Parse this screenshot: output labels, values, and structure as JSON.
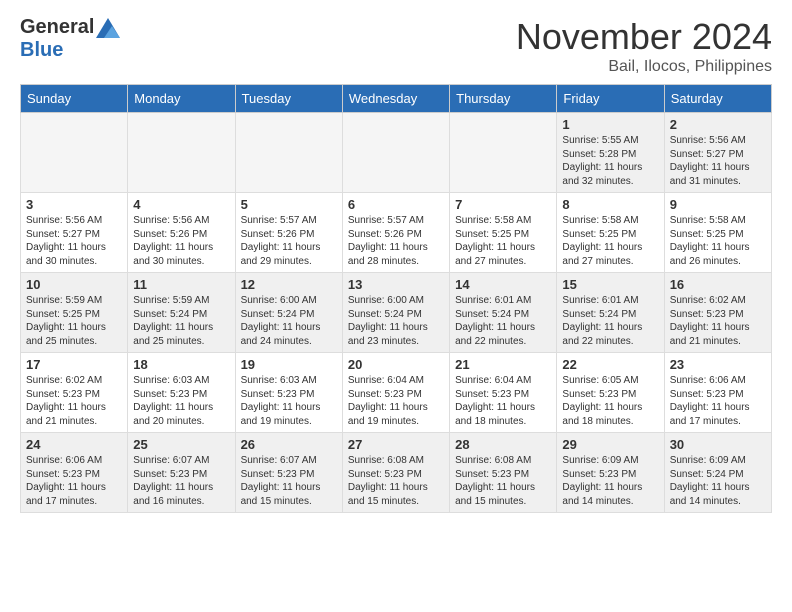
{
  "header": {
    "logo_general": "General",
    "logo_blue": "Blue",
    "month_title": "November 2024",
    "location": "Bail, Ilocos, Philippines"
  },
  "weekdays": [
    "Sunday",
    "Monday",
    "Tuesday",
    "Wednesday",
    "Thursday",
    "Friday",
    "Saturday"
  ],
  "weeks": [
    [
      {
        "day": "",
        "info": "",
        "empty": true
      },
      {
        "day": "",
        "info": "",
        "empty": true
      },
      {
        "day": "",
        "info": "",
        "empty": true
      },
      {
        "day": "",
        "info": "",
        "empty": true
      },
      {
        "day": "",
        "info": "",
        "empty": true
      },
      {
        "day": "1",
        "info": "Sunrise: 5:55 AM\nSunset: 5:28 PM\nDaylight: 11 hours\nand 32 minutes.",
        "empty": false
      },
      {
        "day": "2",
        "info": "Sunrise: 5:56 AM\nSunset: 5:27 PM\nDaylight: 11 hours\nand 31 minutes.",
        "empty": false
      }
    ],
    [
      {
        "day": "3",
        "info": "Sunrise: 5:56 AM\nSunset: 5:27 PM\nDaylight: 11 hours\nand 30 minutes.",
        "empty": false
      },
      {
        "day": "4",
        "info": "Sunrise: 5:56 AM\nSunset: 5:26 PM\nDaylight: 11 hours\nand 30 minutes.",
        "empty": false
      },
      {
        "day": "5",
        "info": "Sunrise: 5:57 AM\nSunset: 5:26 PM\nDaylight: 11 hours\nand 29 minutes.",
        "empty": false
      },
      {
        "day": "6",
        "info": "Sunrise: 5:57 AM\nSunset: 5:26 PM\nDaylight: 11 hours\nand 28 minutes.",
        "empty": false
      },
      {
        "day": "7",
        "info": "Sunrise: 5:58 AM\nSunset: 5:25 PM\nDaylight: 11 hours\nand 27 minutes.",
        "empty": false
      },
      {
        "day": "8",
        "info": "Sunrise: 5:58 AM\nSunset: 5:25 PM\nDaylight: 11 hours\nand 27 minutes.",
        "empty": false
      },
      {
        "day": "9",
        "info": "Sunrise: 5:58 AM\nSunset: 5:25 PM\nDaylight: 11 hours\nand 26 minutes.",
        "empty": false
      }
    ],
    [
      {
        "day": "10",
        "info": "Sunrise: 5:59 AM\nSunset: 5:25 PM\nDaylight: 11 hours\nand 25 minutes.",
        "empty": false
      },
      {
        "day": "11",
        "info": "Sunrise: 5:59 AM\nSunset: 5:24 PM\nDaylight: 11 hours\nand 25 minutes.",
        "empty": false
      },
      {
        "day": "12",
        "info": "Sunrise: 6:00 AM\nSunset: 5:24 PM\nDaylight: 11 hours\nand 24 minutes.",
        "empty": false
      },
      {
        "day": "13",
        "info": "Sunrise: 6:00 AM\nSunset: 5:24 PM\nDaylight: 11 hours\nand 23 minutes.",
        "empty": false
      },
      {
        "day": "14",
        "info": "Sunrise: 6:01 AM\nSunset: 5:24 PM\nDaylight: 11 hours\nand 22 minutes.",
        "empty": false
      },
      {
        "day": "15",
        "info": "Sunrise: 6:01 AM\nSunset: 5:24 PM\nDaylight: 11 hours\nand 22 minutes.",
        "empty": false
      },
      {
        "day": "16",
        "info": "Sunrise: 6:02 AM\nSunset: 5:23 PM\nDaylight: 11 hours\nand 21 minutes.",
        "empty": false
      }
    ],
    [
      {
        "day": "17",
        "info": "Sunrise: 6:02 AM\nSunset: 5:23 PM\nDaylight: 11 hours\nand 21 minutes.",
        "empty": false
      },
      {
        "day": "18",
        "info": "Sunrise: 6:03 AM\nSunset: 5:23 PM\nDaylight: 11 hours\nand 20 minutes.",
        "empty": false
      },
      {
        "day": "19",
        "info": "Sunrise: 6:03 AM\nSunset: 5:23 PM\nDaylight: 11 hours\nand 19 minutes.",
        "empty": false
      },
      {
        "day": "20",
        "info": "Sunrise: 6:04 AM\nSunset: 5:23 PM\nDaylight: 11 hours\nand 19 minutes.",
        "empty": false
      },
      {
        "day": "21",
        "info": "Sunrise: 6:04 AM\nSunset: 5:23 PM\nDaylight: 11 hours\nand 18 minutes.",
        "empty": false
      },
      {
        "day": "22",
        "info": "Sunrise: 6:05 AM\nSunset: 5:23 PM\nDaylight: 11 hours\nand 18 minutes.",
        "empty": false
      },
      {
        "day": "23",
        "info": "Sunrise: 6:06 AM\nSunset: 5:23 PM\nDaylight: 11 hours\nand 17 minutes.",
        "empty": false
      }
    ],
    [
      {
        "day": "24",
        "info": "Sunrise: 6:06 AM\nSunset: 5:23 PM\nDaylight: 11 hours\nand 17 minutes.",
        "empty": false
      },
      {
        "day": "25",
        "info": "Sunrise: 6:07 AM\nSunset: 5:23 PM\nDaylight: 11 hours\nand 16 minutes.",
        "empty": false
      },
      {
        "day": "26",
        "info": "Sunrise: 6:07 AM\nSunset: 5:23 PM\nDaylight: 11 hours\nand 15 minutes.",
        "empty": false
      },
      {
        "day": "27",
        "info": "Sunrise: 6:08 AM\nSunset: 5:23 PM\nDaylight: 11 hours\nand 15 minutes.",
        "empty": false
      },
      {
        "day": "28",
        "info": "Sunrise: 6:08 AM\nSunset: 5:23 PM\nDaylight: 11 hours\nand 15 minutes.",
        "empty": false
      },
      {
        "day": "29",
        "info": "Sunrise: 6:09 AM\nSunset: 5:23 PM\nDaylight: 11 hours\nand 14 minutes.",
        "empty": false
      },
      {
        "day": "30",
        "info": "Sunrise: 6:09 AM\nSunset: 5:24 PM\nDaylight: 11 hours\nand 14 minutes.",
        "empty": false
      }
    ]
  ]
}
